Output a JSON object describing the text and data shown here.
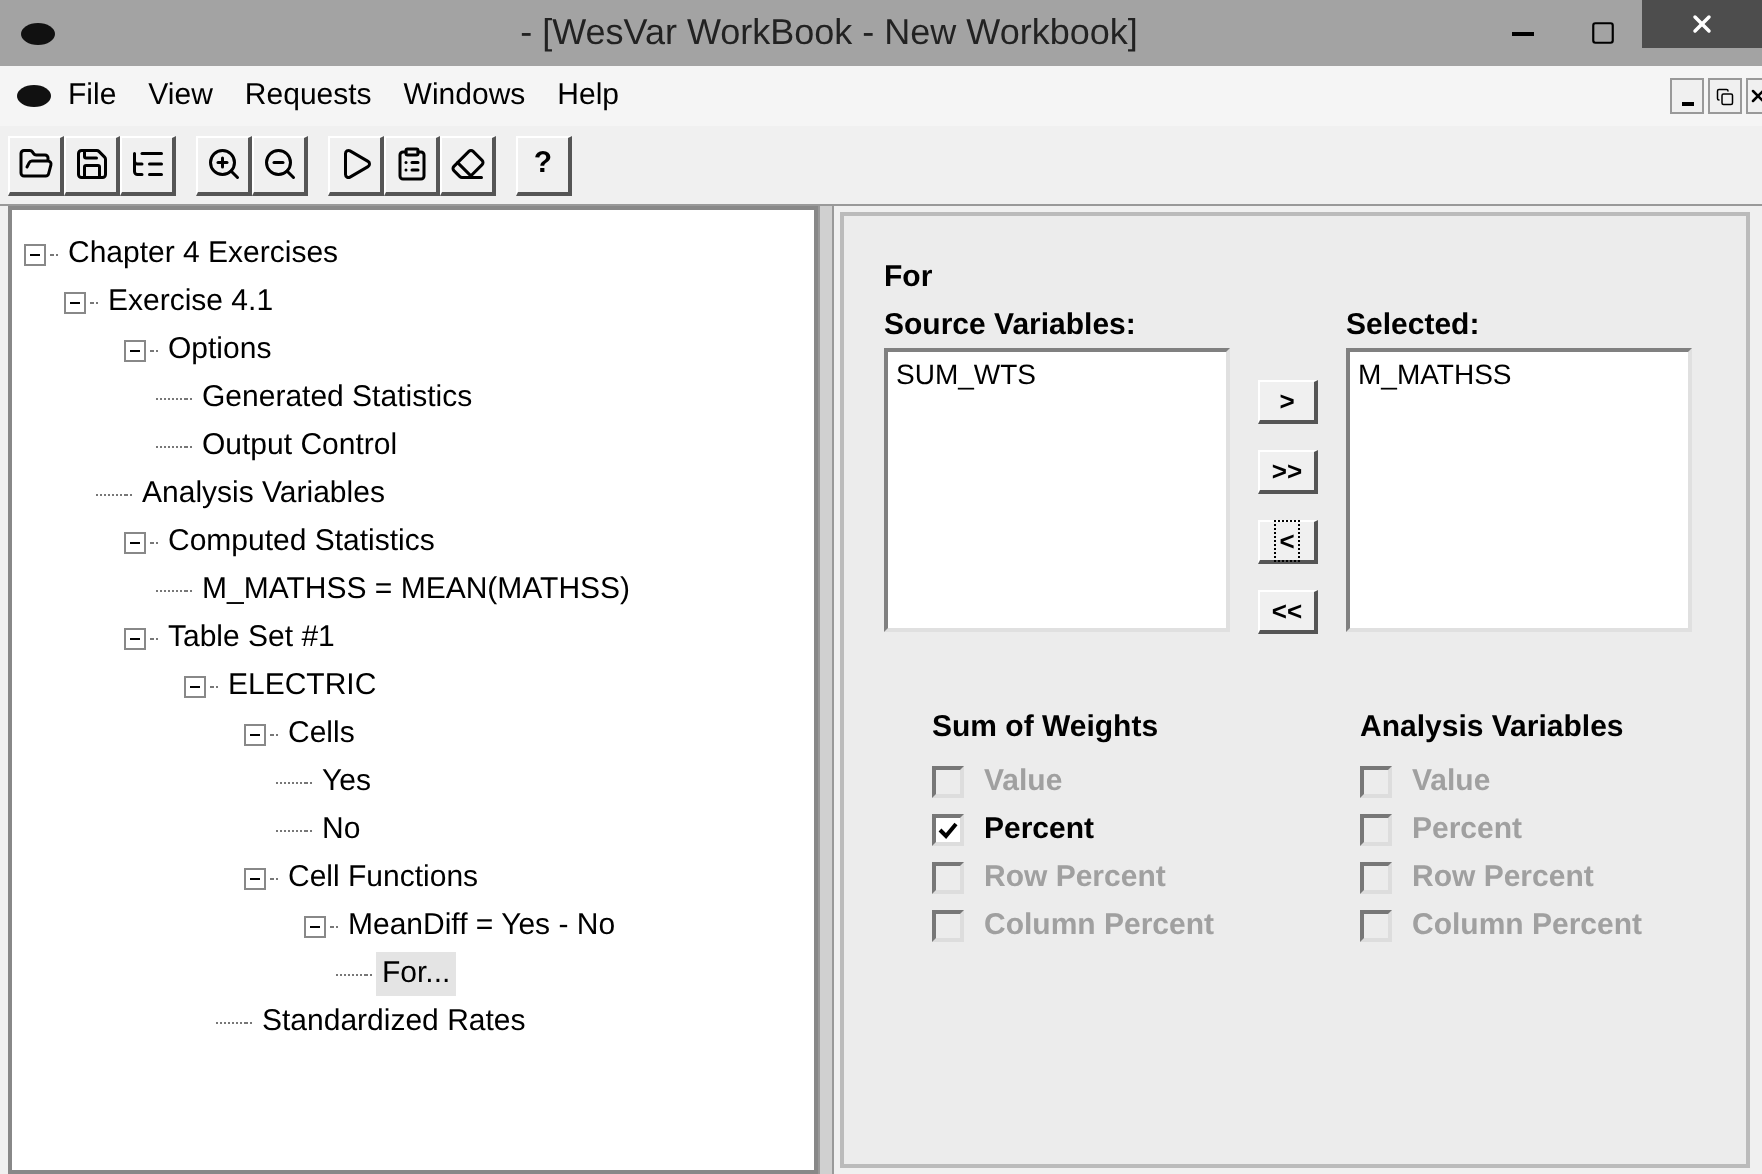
{
  "window": {
    "title": "- [WesVar WorkBook - New Workbook]"
  },
  "menu": [
    "File",
    "View",
    "Requests",
    "Windows",
    "Help"
  ],
  "toolbar": [
    [
      {
        "kind": "open"
      },
      {
        "kind": "save"
      },
      {
        "kind": "list"
      }
    ],
    [
      {
        "kind": "zoom-in"
      },
      {
        "kind": "zoom-out"
      }
    ],
    [
      {
        "kind": "run"
      },
      {
        "kind": "document"
      },
      {
        "kind": "book"
      }
    ],
    [
      {
        "kind": "help",
        "label": "?"
      }
    ]
  ],
  "tree": [
    {
      "label": "Chapter 4 Exercises",
      "expanded": true,
      "selected": false,
      "children": [
        {
          "label": "Exercise 4.1",
          "expanded": true,
          "selected": false,
          "children": [
            {
              "label": "Options",
              "expanded": true,
              "selected": false,
              "children": [
                {
                  "label": "Generated Statistics",
                  "selected": false
                },
                {
                  "label": "Output Control",
                  "selected": false
                }
              ]
            },
            {
              "label": "Analysis Variables",
              "selected": false
            },
            {
              "label": "Computed Statistics",
              "expanded": true,
              "selected": false,
              "children": [
                {
                  "label": "M_MATHSS = MEAN(MATHSS)",
                  "selected": false
                }
              ]
            },
            {
              "label": "Table Set #1",
              "expanded": true,
              "selected": false,
              "children": [
                {
                  "label": "ELECTRIC",
                  "expanded": true,
                  "selected": false,
                  "children": [
                    {
                      "label": "Cells",
                      "expanded": true,
                      "selected": false,
                      "children": [
                        {
                          "label": "Yes",
                          "selected": false
                        },
                        {
                          "label": "No",
                          "selected": false
                        }
                      ]
                    },
                    {
                      "label": "Cell Functions",
                      "expanded": true,
                      "selected": false,
                      "children": [
                        {
                          "label": "MeanDiff = Yes - No",
                          "expanded": true,
                          "selected": false,
                          "children": [
                            {
                              "label": "For...",
                              "selected": true
                            }
                          ]
                        }
                      ]
                    },
                    {
                      "label": "Standardized Rates",
                      "selected": false
                    }
                  ]
                }
              ]
            }
          ]
        }
      ]
    }
  ],
  "form": {
    "heading": "For",
    "source": {
      "label": "Source Variables:",
      "items": [
        "SUM_WTS"
      ]
    },
    "selected": {
      "label": "Selected:",
      "items": [
        "M_MATHSS"
      ]
    },
    "move_buttons": [
      {
        "label": ">",
        "focused": false
      },
      {
        "label": ">>",
        "focused": false
      },
      {
        "label": "<",
        "focused": true
      },
      {
        "label": "<<",
        "focused": false
      }
    ],
    "groups": [
      {
        "title": "Sum of Weights",
        "options": [
          {
            "label": "Value",
            "checked": false,
            "disabled": true
          },
          {
            "label": "Percent",
            "checked": true,
            "disabled": false
          },
          {
            "label": "Row Percent",
            "checked": false,
            "disabled": true
          },
          {
            "label": "Column Percent",
            "checked": false,
            "disabled": true
          }
        ]
      },
      {
        "title": "Analysis Variables",
        "options": [
          {
            "label": "Value",
            "checked": false,
            "disabled": true
          },
          {
            "label": "Percent",
            "checked": false,
            "disabled": true
          },
          {
            "label": "Row Percent",
            "checked": false,
            "disabled": true
          },
          {
            "label": "Column Percent",
            "checked": false,
            "disabled": true
          }
        ]
      }
    ]
  }
}
